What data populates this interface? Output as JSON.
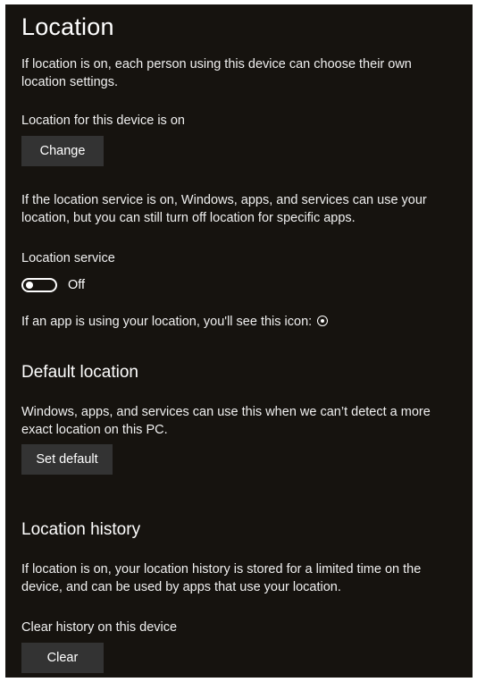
{
  "location": {
    "title": "Location",
    "intro": "If location is on, each person using this device can choose their own location settings.",
    "device_status": "Location for this device is on",
    "change_button": "Change",
    "service_desc": "If the location service is on, Windows, apps, and services can use your location, but you can still turn off location for specific apps.",
    "service_label": "Location service",
    "service_state": "Off",
    "service_on": false,
    "icon_note": "If an app is using your location, you'll see this icon:",
    "icon_name": "location-in-use-icon"
  },
  "default_location": {
    "title": "Default location",
    "desc": "Windows, apps, and services can use this when we can’t detect a more exact location on this PC.",
    "set_default_button": "Set default"
  },
  "history": {
    "title": "Location history",
    "desc": "If location is on, your location history is stored for a limited time on the device, and can be used by apps that use your location.",
    "clear_label": "Clear history on this device",
    "clear_button": "Clear"
  },
  "colors": {
    "background": "#16130f",
    "button": "#333333",
    "text": "#ffffff"
  }
}
